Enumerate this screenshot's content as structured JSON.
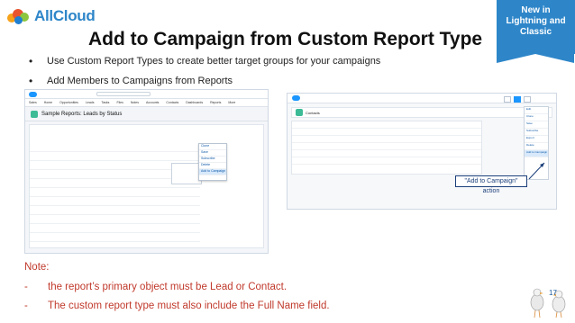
{
  "brand": {
    "name": "AllCloud",
    "colors": [
      "#f6a21a",
      "#e8542e",
      "#8cc63f",
      "#1f7fd1"
    ]
  },
  "ribbon": {
    "lines": [
      "New in",
      "Lightning and",
      "Classic"
    ],
    "color": "#2e86c9"
  },
  "title": "Add to Campaign from Custom Report Type",
  "bullets": [
    "Use Custom Report Types to create better target groups for your campaigns",
    "Add Members to Campaigns from Reports"
  ],
  "shot1": {
    "report_title": "Sample Reports: Leads by Status",
    "nav_items": [
      "Sales",
      "Home",
      "Opportunities",
      "Leads",
      "Tasks",
      "Files",
      "Notes",
      "Accounts",
      "Contacts",
      "Dashboards",
      "Reports",
      "More"
    ],
    "dropdown_items": [
      "Clone",
      "Save",
      "Subscribe",
      "Delete",
      "Add to Campaign"
    ]
  },
  "shot2": {
    "title": "Contacts",
    "side_items": [
      "Edit",
      "Clone",
      "Save",
      "Subscribe",
      "Export",
      "Delete",
      "Add to Campaign"
    ]
  },
  "callout": "\"Add to Campaign\" action",
  "note": {
    "label": "Note:",
    "items": [
      "the report’s primary object must be Lead or Contact.",
      "The custom report type must also include the Full Name field."
    ],
    "color": "#c0392b"
  },
  "page_number": "17"
}
